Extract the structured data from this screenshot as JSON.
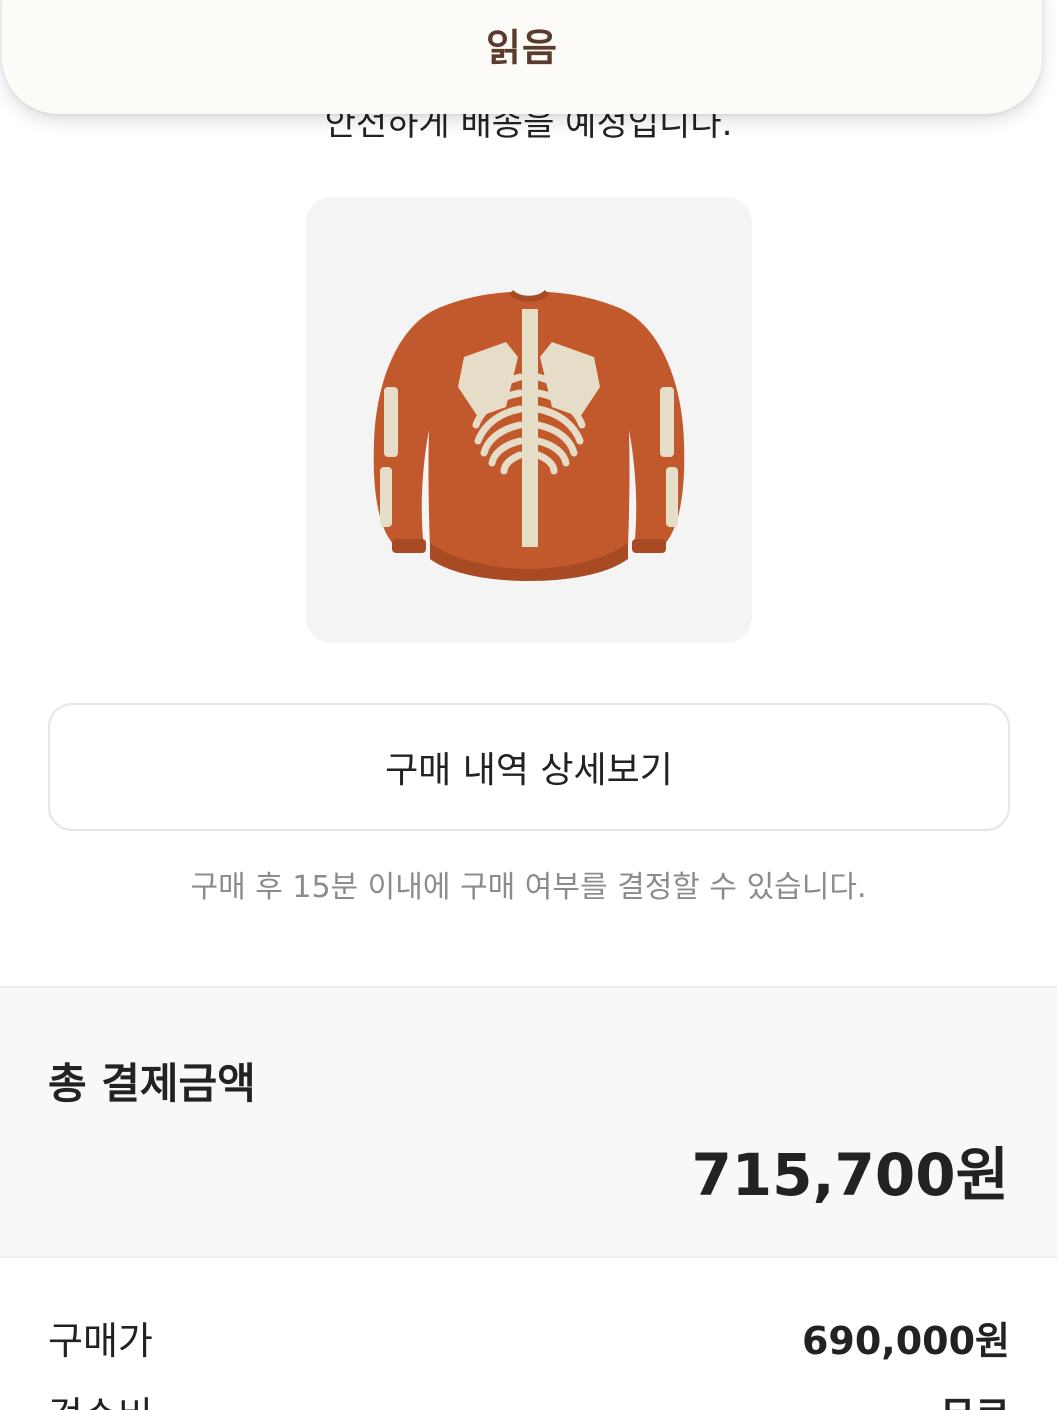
{
  "toast": {
    "label": "읽음"
  },
  "header": {
    "delivery_text": "안전하게 배송을 예정입니다."
  },
  "product": {
    "image_alt": "orange skeleton knit sweater"
  },
  "actions": {
    "detail_button": "구매 내역 상세보기"
  },
  "notice": "구매 후 15분 이내에 구매 여부를 결정할 수 있습니다.",
  "total": {
    "label": "총 결제금액",
    "amount": "715,700원"
  },
  "breakdown": [
    {
      "label": "구매가",
      "value": "690,000원"
    },
    {
      "label": "검수비",
      "value": "무료"
    }
  ],
  "colors": {
    "sweater": "#c2592d",
    "bone": "#e6ddc8",
    "toast_text": "#5a3b2c"
  }
}
